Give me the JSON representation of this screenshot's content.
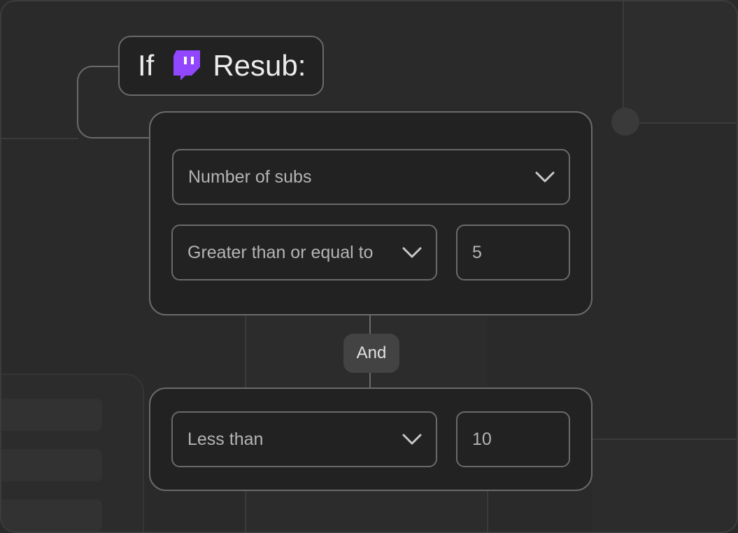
{
  "header": {
    "if_label": "If",
    "trigger_icon": "twitch-icon",
    "trigger_label": "Resub:"
  },
  "condition_1": {
    "field_select": "Number of subs",
    "operator_select": "Greater than or equal to",
    "value": "5"
  },
  "joiner": {
    "label": "And"
  },
  "condition_2": {
    "operator_select": "Less than",
    "value": "10"
  },
  "colors": {
    "twitch_purple": "#9146ff",
    "background": "#2a2a2a",
    "card_bg": "#222222",
    "border": "#6a6a6a"
  }
}
